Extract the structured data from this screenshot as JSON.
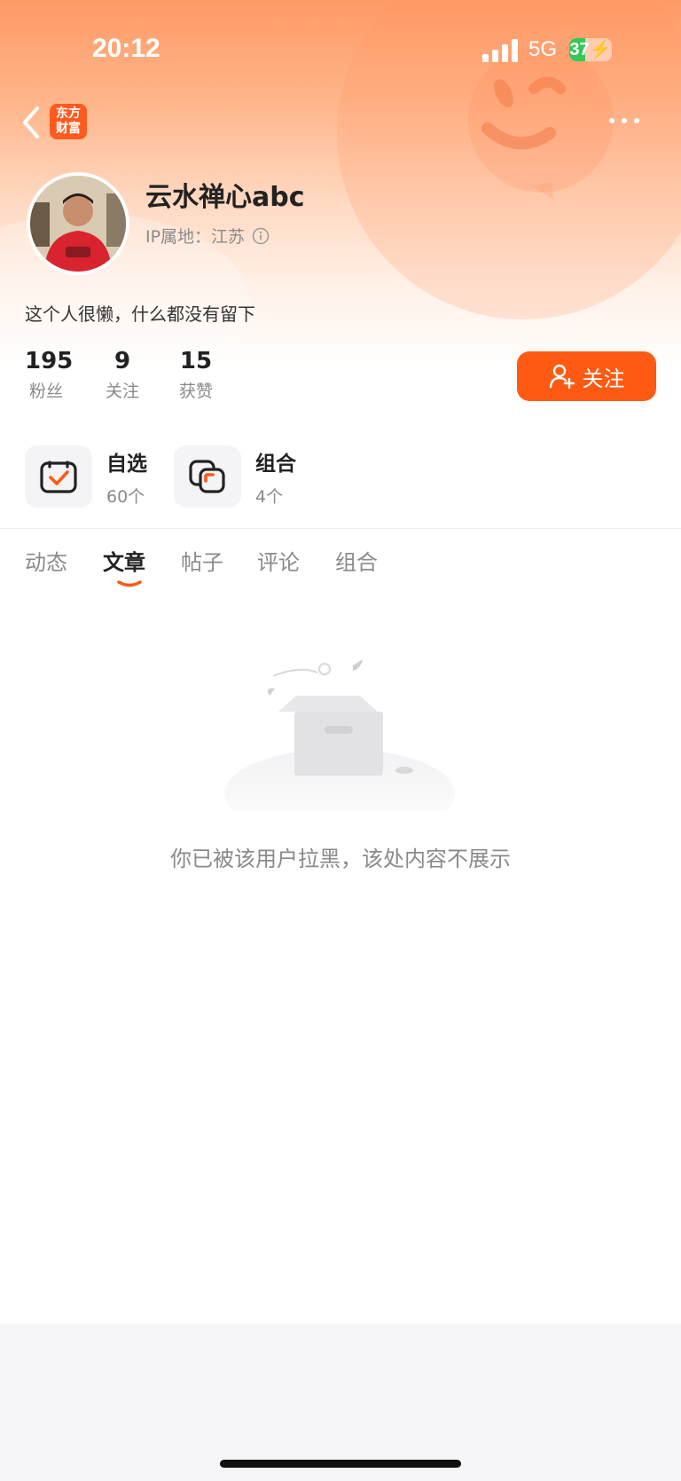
{
  "status_bar": {
    "time": "20:12",
    "network": "5G",
    "battery": "37",
    "battery_level": 0.37
  },
  "header": {
    "app_logo_line1": "东方",
    "app_logo_line2": "财富"
  },
  "profile": {
    "name": "云水禅心abc",
    "ip_location": "IP属地：江苏",
    "bio": "这个人很懒，什么都没有留下"
  },
  "stats": [
    {
      "value": "195",
      "label": "粉丝"
    },
    {
      "value": "9",
      "label": "关注"
    },
    {
      "value": "15",
      "label": "获赞"
    }
  ],
  "follow_button": {
    "label": "关注"
  },
  "shortcuts": [
    {
      "title": "自选",
      "count": "60个"
    },
    {
      "title": "组合",
      "count": "4个"
    }
  ],
  "tabs": [
    {
      "label": "动态"
    },
    {
      "label": "文章"
    },
    {
      "label": "帖子"
    },
    {
      "label": "评论"
    },
    {
      "label": "组合"
    }
  ],
  "active_tab": "文章",
  "empty_state": {
    "message": "你已被该用户拉黑，该处内容不展示"
  },
  "colors": {
    "accent": "#ff5a14",
    "brand": "#ff5a1f"
  }
}
